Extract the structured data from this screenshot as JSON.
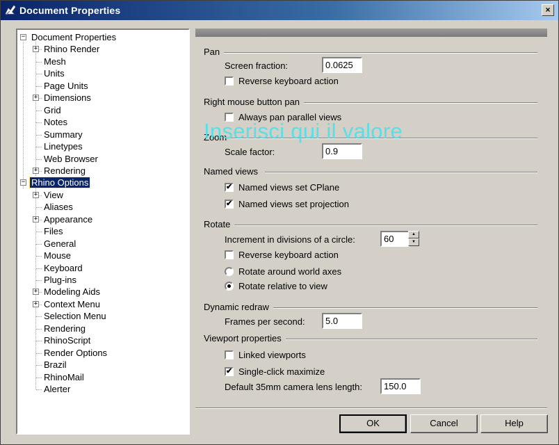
{
  "window": {
    "title": "Document Properties",
    "close_label": "×"
  },
  "tree": {
    "items": [
      {
        "label": "Document Properties",
        "level": 0,
        "expander": "minus"
      },
      {
        "label": "Rhino Render",
        "level": 1,
        "expander": "plus"
      },
      {
        "label": "Mesh",
        "level": 1,
        "expander": ""
      },
      {
        "label": "Units",
        "level": 1,
        "expander": ""
      },
      {
        "label": "Page Units",
        "level": 1,
        "expander": ""
      },
      {
        "label": "Dimensions",
        "level": 1,
        "expander": "plus"
      },
      {
        "label": "Grid",
        "level": 1,
        "expander": ""
      },
      {
        "label": "Notes",
        "level": 1,
        "expander": ""
      },
      {
        "label": "Summary",
        "level": 1,
        "expander": ""
      },
      {
        "label": "Linetypes",
        "level": 1,
        "expander": ""
      },
      {
        "label": "Web Browser",
        "level": 1,
        "expander": ""
      },
      {
        "label": "Rendering",
        "level": 1,
        "expander": "plus"
      },
      {
        "label": "Rhino Options",
        "level": 0,
        "expander": "minus",
        "selected": true
      },
      {
        "label": "View",
        "level": 1,
        "expander": "plus"
      },
      {
        "label": "Aliases",
        "level": 1,
        "expander": ""
      },
      {
        "label": "Appearance",
        "level": 1,
        "expander": "plus"
      },
      {
        "label": "Files",
        "level": 1,
        "expander": ""
      },
      {
        "label": "General",
        "level": 1,
        "expander": ""
      },
      {
        "label": "Mouse",
        "level": 1,
        "expander": ""
      },
      {
        "label": "Keyboard",
        "level": 1,
        "expander": ""
      },
      {
        "label": "Plug-ins",
        "level": 1,
        "expander": ""
      },
      {
        "label": "Modeling Aids",
        "level": 1,
        "expander": "plus"
      },
      {
        "label": "Context Menu",
        "level": 1,
        "expander": "plus"
      },
      {
        "label": "Selection Menu",
        "level": 1,
        "expander": ""
      },
      {
        "label": "Rendering",
        "level": 1,
        "expander": ""
      },
      {
        "label": "RhinoScript",
        "level": 1,
        "expander": ""
      },
      {
        "label": "Render Options",
        "level": 1,
        "expander": ""
      },
      {
        "label": "Brazil",
        "level": 1,
        "expander": ""
      },
      {
        "label": "RhinoMail",
        "level": 1,
        "expander": ""
      },
      {
        "label": "Alerter",
        "level": 1,
        "expander": ""
      }
    ]
  },
  "pan": {
    "group": "Pan",
    "screen_fraction_label": "Screen fraction:",
    "screen_fraction_value": "0.0625",
    "reverse_keyboard_label": "Reverse keyboard action",
    "reverse_keyboard_checked": false
  },
  "right_mouse": {
    "group": "Right mouse button pan",
    "always_pan_label": "Always pan parallel views",
    "always_pan_checked": false
  },
  "zoom": {
    "group": "Zoom",
    "scale_factor_label": "Scale factor:",
    "scale_factor_value": "0.9"
  },
  "watermark": "Inserisci qui il valore",
  "named_views": {
    "group": "Named views",
    "cplane_label": "Named views set CPlane",
    "cplane_checked": true,
    "projection_label": "Named views set projection",
    "projection_checked": true
  },
  "rotate": {
    "group": "Rotate",
    "increment_label": "Increment in divisions of a circle:",
    "increment_value": "60",
    "reverse_keyboard_label": "Reverse keyboard action",
    "reverse_keyboard_checked": false,
    "world_axes_label": "Rotate around world axes",
    "relative_view_label": "Rotate relative to view",
    "selected_option": "relative_view"
  },
  "dynamic_redraw": {
    "group": "Dynamic redraw",
    "fps_label": "Frames per second:",
    "fps_value": "5.0"
  },
  "viewport": {
    "group": "Viewport properties",
    "linked_label": "Linked viewports",
    "linked_checked": false,
    "single_click_label": "Single-click maximize",
    "single_click_checked": true,
    "lens_label": "Default 35mm camera lens length:",
    "lens_value": "150.0"
  },
  "buttons": {
    "ok": "OK",
    "cancel": "Cancel",
    "help": "Help"
  },
  "icons": {
    "expand_plus": "plus-icon",
    "collapse_minus": "minus-icon",
    "check": "check-icon"
  }
}
